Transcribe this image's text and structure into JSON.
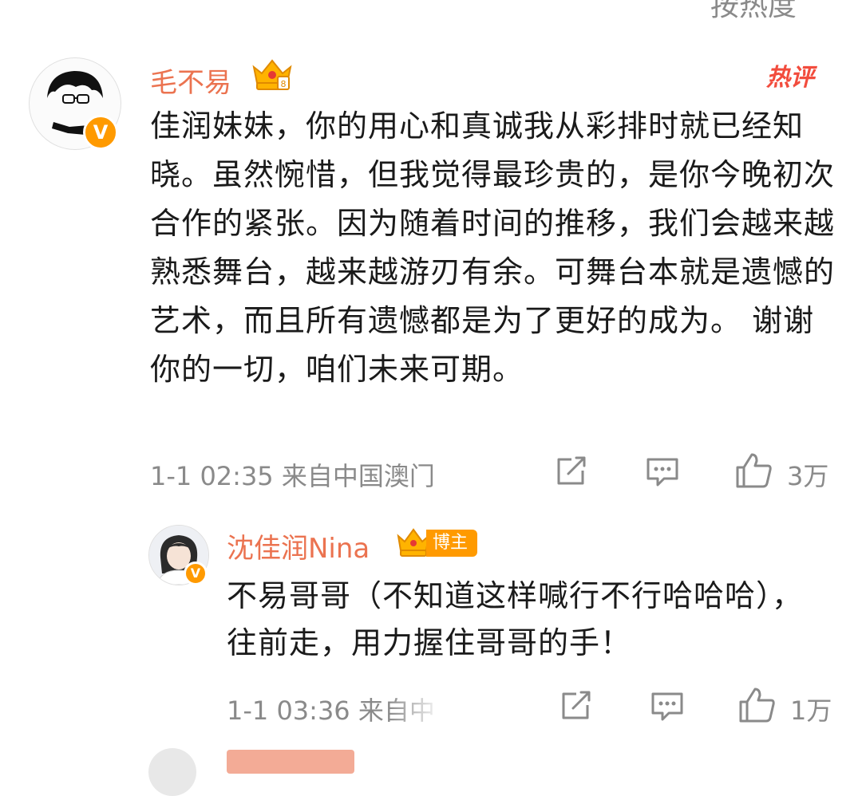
{
  "sort_label": "按热度",
  "comment": {
    "author": "毛不易",
    "hot_tag": "热评",
    "text": "佳润妹妹，你的用心和真诚我从彩排时就已经知晓。虽然惋惜，但我觉得最珍贵的，是你今晚初次合作的紧张。因为随着时间的推移，我们会越来越熟悉舞台，越来越游刃有余。可舞台本就是遗憾的艺术，而且所有遗憾都是为了更好的成为。 谢谢你的一切，咱们未来可期。",
    "time": "1-1 02:35",
    "location": "来自中国澳门",
    "likes": "3万",
    "icons": {
      "share": "share-icon",
      "comment": "comment-icon",
      "like": "like-icon",
      "verified": "verified-v-icon",
      "fan_crown": "crown-badge-icon"
    }
  },
  "reply": {
    "author": "沈佳润Nina",
    "role_tag": "博主",
    "text": "不易哥哥（不知道这样喊行不行哈哈哈），往前走，用力握住哥哥的手！",
    "time": "1-1 03:36",
    "location_partial": "来自中",
    "likes": "1万"
  },
  "colors": {
    "name": "#eb7350",
    "meta": "#8a8a8a",
    "badge": "#ff9a00",
    "hot": "#f24c3d"
  }
}
